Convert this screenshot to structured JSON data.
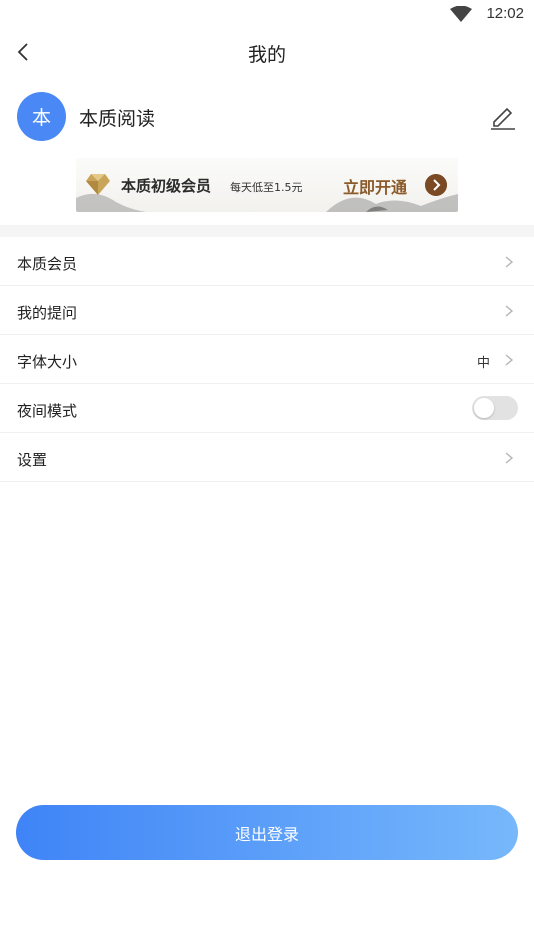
{
  "status_bar": {
    "time": "12:02",
    "wifi_icon": "wifi-icon"
  },
  "nav": {
    "title": "我的",
    "back_icon": "back-arrow-icon"
  },
  "profile": {
    "avatar_text": "本",
    "username": "本质阅读",
    "edit_icon": "edit-pencil-icon",
    "avatar_color": "#4a88f5"
  },
  "banner": {
    "title": "本质初级会员",
    "desc": "每天低至1.5元",
    "cta": "立即开通",
    "icon": "diamond-icon",
    "cta_icon": "chevron-right-icon",
    "accent": "#8a5a2a"
  },
  "menu": {
    "items": [
      {
        "label": "本质会员",
        "type": "link"
      },
      {
        "label": "我的提问",
        "type": "link"
      },
      {
        "label": "字体大小",
        "type": "link",
        "value": "中"
      },
      {
        "label": "夜间模式",
        "type": "toggle",
        "on": false
      },
      {
        "label": "设置",
        "type": "link"
      }
    ]
  },
  "logout": {
    "label": "退出登录",
    "gradient": [
      "#3f84f7",
      "#77b8fb"
    ]
  }
}
